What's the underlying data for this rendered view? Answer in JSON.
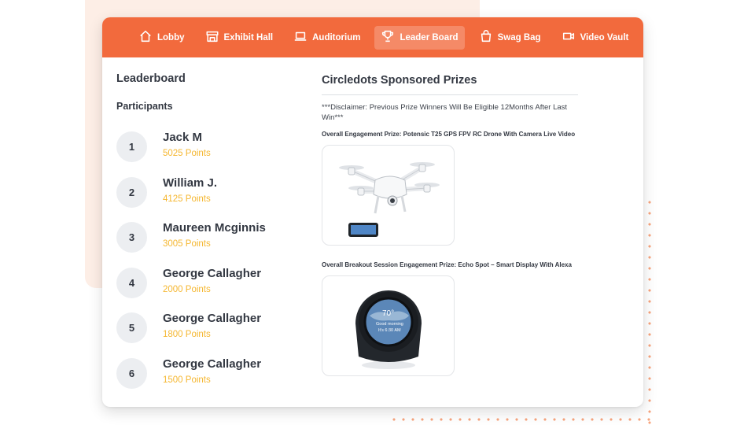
{
  "nav": {
    "items": [
      {
        "label": "Lobby",
        "icon": "home-icon"
      },
      {
        "label": "Exhibit Hall",
        "icon": "storefront-icon"
      },
      {
        "label": "Auditorium",
        "icon": "laptop-icon"
      },
      {
        "label": "Leader Board",
        "icon": "trophy-icon",
        "active": true
      },
      {
        "label": "Swag Bag",
        "icon": "shopping-bag-icon"
      },
      {
        "label": "Video Vault",
        "icon": "video-camera-icon"
      }
    ]
  },
  "leaderboard": {
    "title": "Leaderboard",
    "participants_label": "Participants",
    "participants": [
      {
        "rank": "1",
        "name": "Jack M",
        "points": "5025 Points"
      },
      {
        "rank": "2",
        "name": "William J.",
        "points": "4125 Points"
      },
      {
        "rank": "3",
        "name": "Maureen Mcginnis",
        "points": "3005 Points"
      },
      {
        "rank": "4",
        "name": "George Callagher",
        "points": "2000 Points"
      },
      {
        "rank": "5",
        "name": "George Callagher",
        "points": "1800 Points"
      },
      {
        "rank": "6",
        "name": "George Callagher",
        "points": "1500 Points"
      }
    ]
  },
  "prizes": {
    "title": "Circledots Sponsored Prizes",
    "disclaimer": "***Disclaimer: Previous Prize Winners Will Be Eligible 12Months After Last Win***",
    "items": [
      {
        "label": "Overall Engagement Prize: Potensic T25 GPS FPV RC Drone With Camera Live Video",
        "image": "drone-image"
      },
      {
        "label": "Overall Breakout Session Engagement Prize: Echo Spot – Smart Display With Alexa",
        "image": "echo-spot-image"
      }
    ],
    "echo_screen": {
      "temp": "70°",
      "line1": "Good morning",
      "line2": "It's 6:30 AM"
    }
  },
  "colors": {
    "accent": "#f26a3d",
    "points": "#f5b731",
    "text": "#333842"
  }
}
